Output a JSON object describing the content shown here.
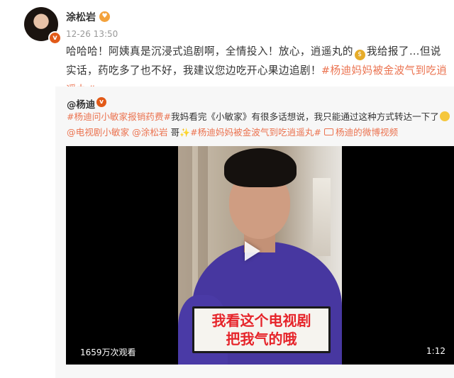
{
  "post": {
    "username": "涂松岩",
    "avatar_badge": "v",
    "vip_icon": "vip-heart-icon",
    "meta": "12-26 13:50",
    "text_part1": "哈哈哈！阿姨真是沉浸式追剧啊，全情投入！放心，逍遥丸的",
    "coin_icon": "money-bag-icon",
    "text_part2": "我给报了…但说实话，药吃多了也不好，我建议您边吃开心果边追剧！",
    "hashtag": "#杨迪妈妈被金波气到吃逍遥丸#"
  },
  "repost": {
    "username": "@杨迪",
    "verified": "v",
    "hashtag1": "#杨迪问小敏家报销药费#",
    "text1": "我妈看完《小敏家》有很多话想说，我只能通过这种方式转达一下了",
    "mention1": "@电视剧小敏家",
    "mention2": "@涂松岩",
    "text2": " 哥",
    "hashtag2": "#杨迪妈妈被金波气到吃逍遥丸#",
    "video_link": "杨迪的微博视频"
  },
  "video": {
    "caption_line1": "我看这个电视剧",
    "caption_line2": "把我气的哦",
    "views": "1659万次观看",
    "duration": "1:12"
  }
}
